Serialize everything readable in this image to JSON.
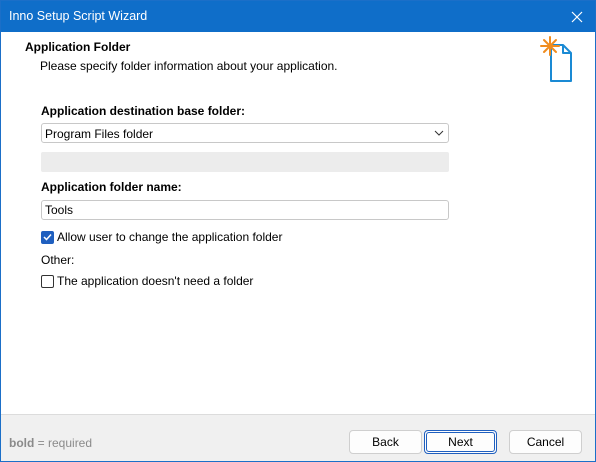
{
  "window": {
    "title": "Inno Setup Script Wizard"
  },
  "header": {
    "title": "Application Folder",
    "subtitle": "Please specify folder information about your application."
  },
  "form": {
    "base_folder_label": "Application destination base folder:",
    "base_folder_value": "Program Files folder",
    "folder_name_label": "Application folder name:",
    "folder_name_value": "Tools",
    "allow_change_label": "Allow user to change the application folder",
    "allow_change_checked": true,
    "other_label": "Other:",
    "no_folder_label": "The application doesn't need a folder",
    "no_folder_checked": false
  },
  "footer": {
    "hint_bold": "bold",
    "hint_rest": " = required",
    "back_label": "Back",
    "next_label": "Next",
    "cancel_label": "Cancel"
  },
  "colors": {
    "titlebar": "#0f6ec9",
    "accent": "#1f5fbf",
    "star": "#f08c1e",
    "page_icon": "#1a8ad4"
  },
  "icons": [
    "close-icon",
    "wizard-page-icon",
    "chevron-down-icon",
    "checkmark-icon"
  ]
}
